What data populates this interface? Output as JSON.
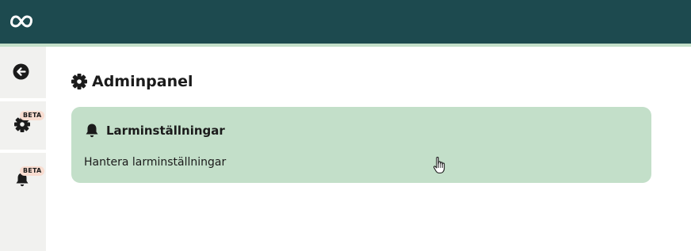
{
  "header": {
    "logo_icon": "infinity-logo-icon",
    "background": "#1d4a4f",
    "accent": "#c3dfc9"
  },
  "sidebar": {
    "items": [
      {
        "icon": "back-arrow-icon",
        "badge": ""
      },
      {
        "icon": "gear-icon",
        "badge": "BETA"
      },
      {
        "icon": "bell-icon",
        "badge": "BETA"
      }
    ]
  },
  "main": {
    "title": "Adminpanel",
    "title_icon": "gear-icon",
    "card": {
      "icon": "bell-icon",
      "title": "Larminställningar",
      "description": "Hantera larminställningar",
      "background": "#c3dfc9"
    }
  }
}
